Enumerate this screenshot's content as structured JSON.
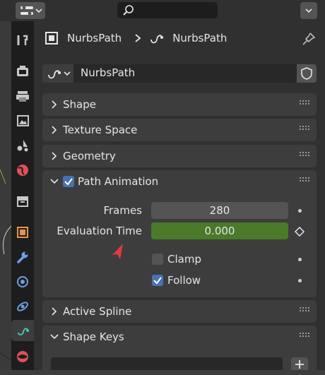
{
  "header": {
    "editor_type_icon": "properties-editor-icon",
    "search_placeholder": "",
    "options_icon": "chevron-down-icon"
  },
  "tabs": [
    {
      "name": "tool-tab",
      "icon": "wrench-screwdriver-icon"
    },
    {
      "name": "render-tab",
      "icon": "camera-back-icon"
    },
    {
      "name": "output-tab",
      "icon": "printer-icon"
    },
    {
      "name": "view-layer-tab",
      "icon": "image-icon"
    },
    {
      "name": "scene-tab",
      "icon": "scene-icon"
    },
    {
      "name": "world-tab",
      "icon": "world-icon"
    },
    {
      "name": "collection-tab",
      "icon": "collection-box-icon"
    },
    {
      "name": "object-tab",
      "icon": "object-square-icon"
    },
    {
      "name": "modifiers-tab",
      "icon": "wrench-icon"
    },
    {
      "name": "particles-tab",
      "icon": "particles-icon"
    },
    {
      "name": "physics-tab",
      "icon": "physics-orbit-icon"
    },
    {
      "name": "curve-data-tab",
      "icon": "curve-icon",
      "active": true
    },
    {
      "name": "material-tab",
      "icon": "material-sphere-icon"
    }
  ],
  "breadcrumb": {
    "object_name": "NurbsPath",
    "data_name": "NurbsPath",
    "separator": "›"
  },
  "datablock": {
    "name": "NurbsPath"
  },
  "panels": {
    "shape": "Shape",
    "texture_space": "Texture Space",
    "geometry": "Geometry",
    "path_animation": "Path Animation",
    "active_spline": "Active Spline",
    "shape_keys": "Shape Keys"
  },
  "path_animation": {
    "enabled": true,
    "frames_label": "Frames",
    "frames_value": "280",
    "eval_time_label": "Evaluation Time",
    "eval_time_value": "0.000",
    "clamp_label": "Clamp",
    "clamp_checked": false,
    "follow_label": "Follow",
    "follow_checked": true
  },
  "colors": {
    "eval_field": "#4a7a2a",
    "checkbox_on": "#4772b3",
    "curve_accent": "#44c9b3"
  }
}
